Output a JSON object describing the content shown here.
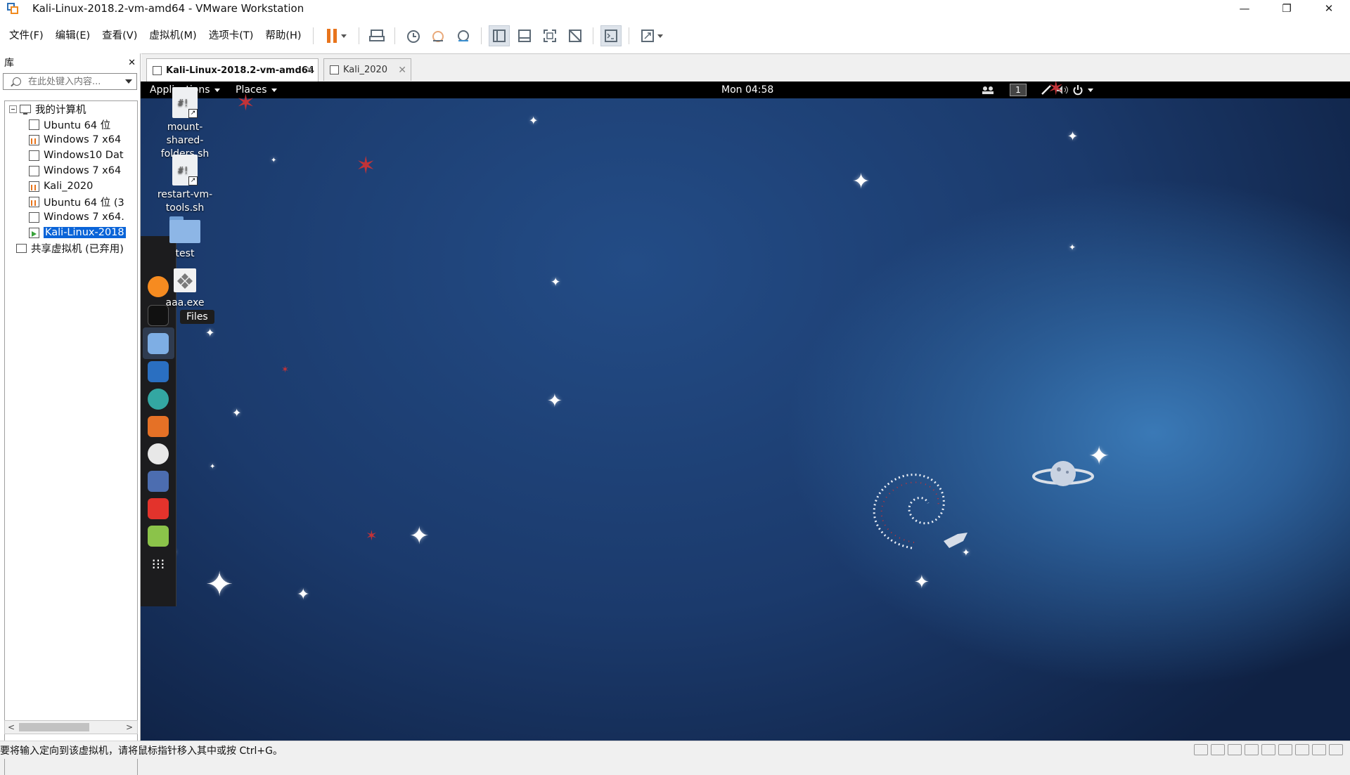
{
  "window": {
    "title": "Kali-Linux-2018.2-vm-amd64 - VMware Workstation",
    "controls": {
      "minimize": "—",
      "restore": "❐",
      "close": "✕"
    }
  },
  "menu": {
    "items": [
      "文件(F)",
      "编辑(E)",
      "查看(V)",
      "虚拟机(M)",
      "选项卡(T)",
      "帮助(H)"
    ]
  },
  "library": {
    "title": "库",
    "close": "✕",
    "search_placeholder": "在此处键入内容...",
    "tree": {
      "root": "我的计算机",
      "vms": [
        {
          "label": "Ubuntu 64 位",
          "state": "off"
        },
        {
          "label": "Windows 7 x64",
          "state": "suspended"
        },
        {
          "label": "Windows10  Dat",
          "state": "off"
        },
        {
          "label": "Windows 7 x64",
          "state": "off"
        },
        {
          "label": "Kali_2020",
          "state": "suspended"
        },
        {
          "label": "Ubuntu 64 位 (3",
          "state": "suspended"
        },
        {
          "label": "Windows 7 x64.",
          "state": "off"
        },
        {
          "label": "Kali-Linux-2018",
          "state": "running",
          "selected": true
        }
      ],
      "shared": "共享虚拟机 (已弃用)"
    }
  },
  "tabs": [
    {
      "label": "Kali-Linux-2018.2-vm-amd64",
      "active": true
    },
    {
      "label": "Kali_2020",
      "active": false
    }
  ],
  "guest": {
    "topbar": {
      "applications": "Applications",
      "places": "Places",
      "clock": "Mon 04:58",
      "workspace": "1"
    },
    "desktop_icons": [
      {
        "label": "mount-shared-folders.sh",
        "line1": "mount-",
        "line2": "shared-",
        "line3": "folders.sh"
      },
      {
        "label": "restart-vm-tools.sh",
        "line1": "restart-vm-",
        "line2": "tools.sh"
      },
      {
        "label": "test"
      },
      {
        "label": "aaa.exe"
      }
    ],
    "tooltip": "Files",
    "dock": [
      "firefox-icon",
      "terminal-icon",
      "files-icon",
      "metasploit-icon",
      "armitage-icon",
      "burpsuite-icon",
      "maltego-icon",
      "beef-icon",
      "faraday-icon",
      "notes-icon",
      "show-apps-icon"
    ],
    "colors": {
      "background": "#1b3a6c",
      "accent_glow": "#3a79b6",
      "star_red": "#c23338"
    }
  },
  "statusbar": {
    "message": "要将输入定向到该虚拟机，请将鼠标指针移入其中或按 Ctrl+G。"
  },
  "colors": {
    "selection": "#0a64d8",
    "pause": "#e8741c"
  }
}
